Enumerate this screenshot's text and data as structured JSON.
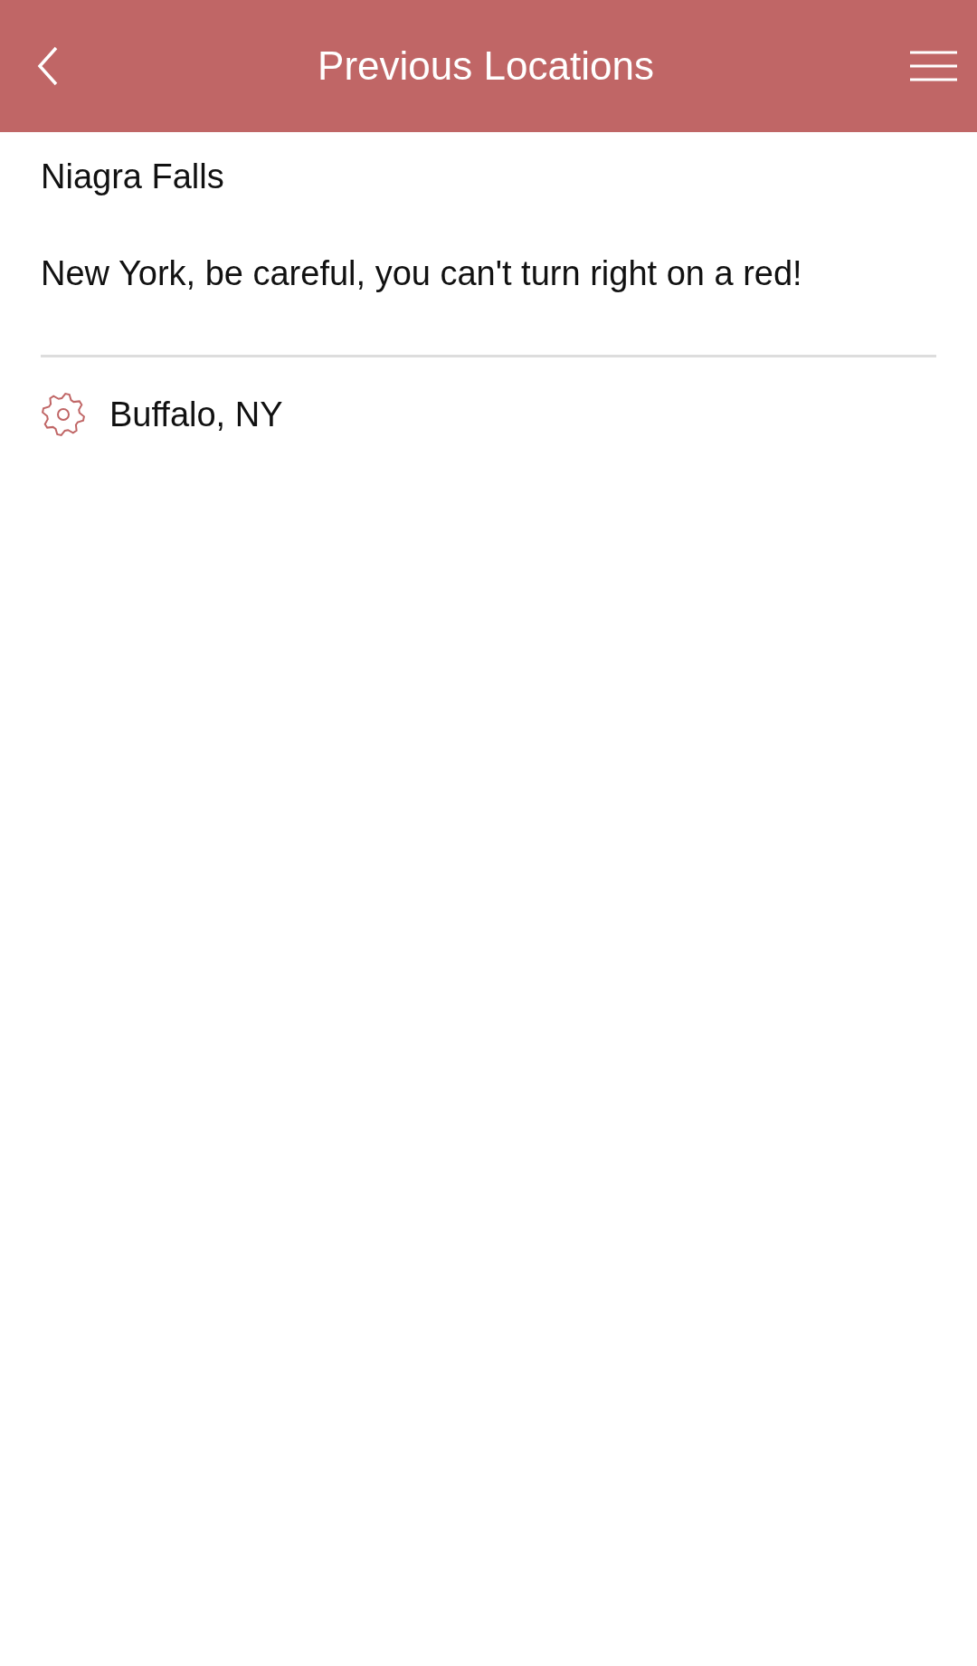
{
  "header": {
    "title": "Previous Locations"
  },
  "location": {
    "name": "Niagra Falls",
    "note": "New York, be careful, you can't turn right on a red!"
  },
  "items": [
    {
      "label": "Buffalo, NY"
    }
  ]
}
